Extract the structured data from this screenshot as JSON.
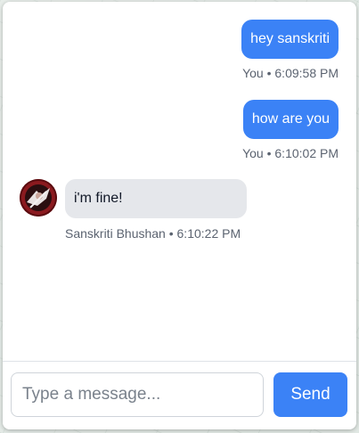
{
  "messages": [
    {
      "sender": "self",
      "text": "hey sanskriti",
      "meta": "You • 6:09:58 PM"
    },
    {
      "sender": "self",
      "text": "how are you",
      "meta": "You • 6:10:02 PM"
    },
    {
      "sender": "other",
      "text": "i'm fine!",
      "meta": "Sanskriti Bhushan • 6:10:22 PM",
      "avatar_icon": "user-avatar-photo"
    }
  ],
  "composer": {
    "placeholder": "Type a message...",
    "value": "",
    "send_label": "Send"
  },
  "colors": {
    "accent": "#3b82f6",
    "received_bubble": "#e5e7eb",
    "meta_text": "#5b6370"
  }
}
